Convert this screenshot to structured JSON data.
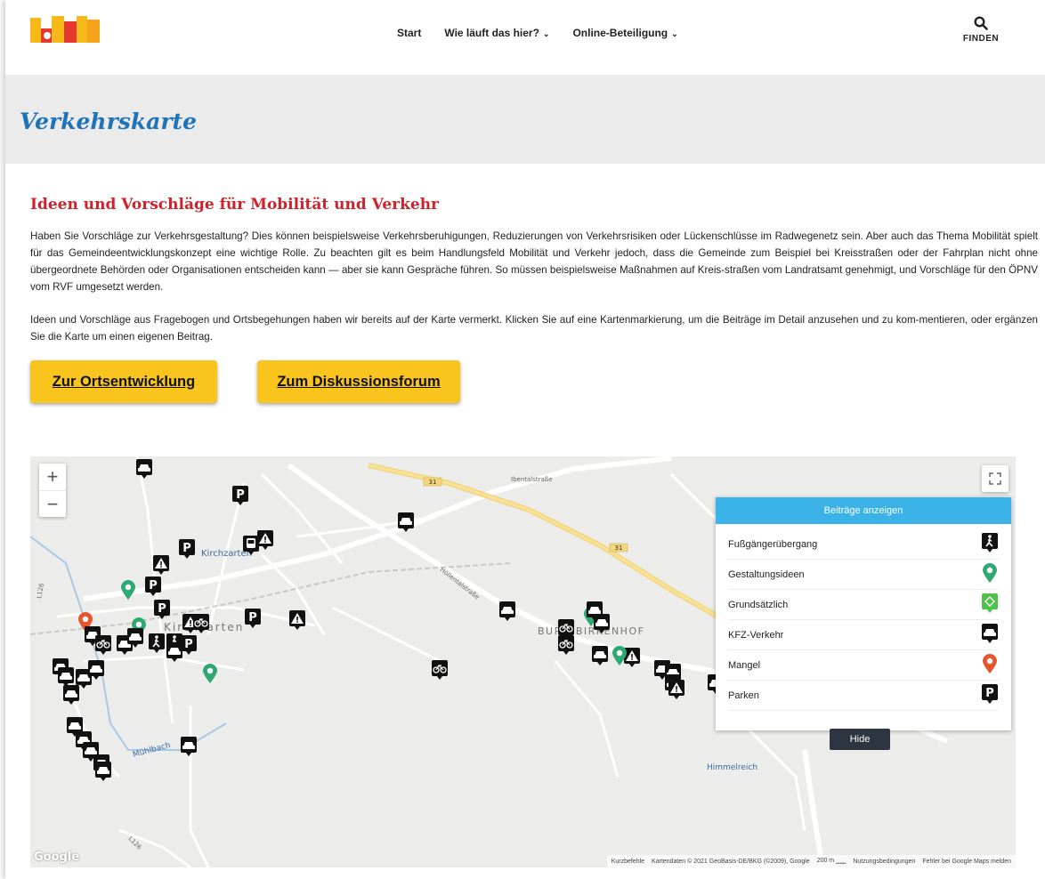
{
  "header": {
    "nav": [
      {
        "label": "Start",
        "has_menu": false
      },
      {
        "label": "Wie läuft das hier?",
        "has_menu": true
      },
      {
        "label": "Online-Beteiligung",
        "has_menu": true
      }
    ],
    "search_label": "FINDEN"
  },
  "page_title": "Verkehrskarte",
  "content": {
    "subtitle": "Ideen und Vorschläge für Mobilität und Verkehr",
    "paragraph1": "Haben Sie Vorschläge zur Verkehrsgestaltung? Dies können beispielsweise Verkehrsberuhigungen, Reduzierungen von Verkehrsrisiken oder Lückenschlüsse im Radwegenetz sein. Aber auch das Thema Mobilität spielt für das Gemeindeentwicklungskonzept eine wichtige Rolle. Zu beachten gilt es beim Handlungsfeld Mobilität und Verkehr  jedoch, dass die Gemeinde zum Beispiel bei Kreisstraßen oder der Fahrplan nicht ohne übergeordnete Behörden oder Organisationen entscheiden kann — aber sie kann Gespräche führen. So müssen beispielsweise Maßnahmen auf Kreis-straßen vom Landratsamt genehmigt, und Vorschläge für den ÖPNV vom RVF umgesetzt werden.",
    "paragraph2": "Ideen und Vorschläge aus Fragebogen und Ortsbegehungen haben wir bereits auf der Karte vermerkt. Klicken Sie auf eine Kartenmarkierung, um die Beiträge im Detail anzusehen und zu kom-mentieren, oder ergänzen Sie die Karte um einen eigenen Beitrag.",
    "buttons": {
      "ortsentwicklung": "Zur Ortsentwicklung",
      "forum": "Zum Diskussionsforum"
    }
  },
  "map": {
    "zoom_in": "+",
    "zoom_out": "−",
    "panel": {
      "title": "Beiträge anzeigen",
      "items": [
        {
          "label": "Fußgängerübergang",
          "icon": "pedestrian-crossing-icon"
        },
        {
          "label": "Gestaltungsideen",
          "icon": "green-pin-icon"
        },
        {
          "label": "Grundsätzlich",
          "icon": "general-icon"
        },
        {
          "label": "KFZ-Verkehr",
          "icon": "car-icon"
        },
        {
          "label": "Mangel",
          "icon": "orange-pin-icon"
        },
        {
          "label": "Parken",
          "icon": "parking-icon"
        }
      ],
      "hide_label": "Hide"
    },
    "labels": {
      "kirchzarten_station": "Kirchzarten",
      "kirchzarten_town": "Kirchzarten",
      "birkenhof": "BURG-BIRKENHOF",
      "himmelreich": "Himmelreich",
      "muehlbach": "Mühlbach",
      "hoellentalstrasse": "Höllentalstraße",
      "ibentalstrasse": "Ibentalstraße",
      "route_31": "31",
      "l126": "L126",
      "l126_south": "L126"
    },
    "google": "Google",
    "attribution": {
      "shortcuts": "Kurzbefehle",
      "data": "Kartendaten © 2021 GeoBasis-DE/BKG (©2009), Google",
      "scale": "200 m",
      "terms": "Nutzungsbedingungen",
      "report": "Fehler bei Google Maps melden"
    }
  },
  "colors": {
    "accent_blue": "#1f74b8",
    "subtitle_red": "#d0202a",
    "button_yellow": "#f9c41e",
    "panel_blue": "#3bb3e8",
    "marker_green": "#2fa874",
    "marker_orange": "#e8542a"
  }
}
